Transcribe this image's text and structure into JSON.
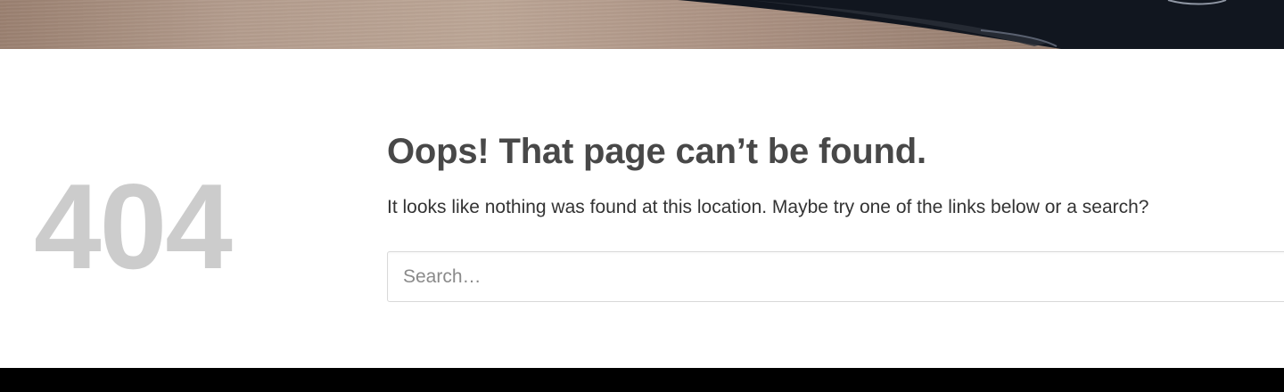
{
  "hero": {
    "image_alt": "header-image"
  },
  "error": {
    "code": "404",
    "title": "Oops! That page can’t be found.",
    "description": "It looks like nothing was found at this location. Maybe try one of the links below or a search?"
  },
  "search": {
    "placeholder": "Search…",
    "value": ""
  },
  "colors": {
    "code_gray": "#cccccc",
    "title": "#484848",
    "text": "#333333",
    "footer": "#000000"
  }
}
